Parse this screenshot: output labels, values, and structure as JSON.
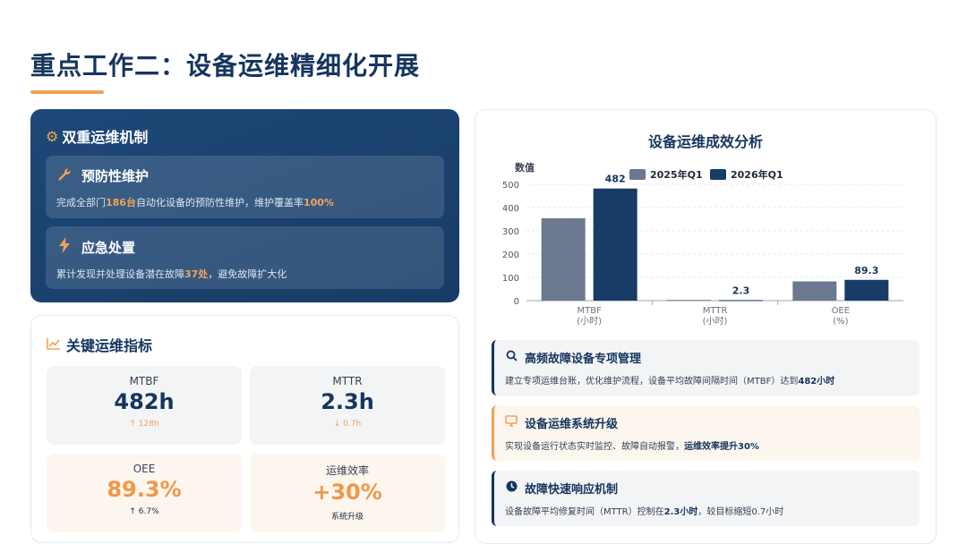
{
  "header": {
    "title": "重点工作二：设备运维精细化开展"
  },
  "mechanism": {
    "title": "双重运维机制",
    "title_icon": "gear-icon",
    "items": [
      {
        "icon": "wrench-icon",
        "title": "预防性维护",
        "desc_prefix": "完成全部门",
        "desc_highlight1": "186台",
        "desc_mid": "自动化设备的预防性维护，维护覆盖率",
        "desc_highlight2": "100%"
      },
      {
        "icon": "lightning-icon",
        "title": "应急处置",
        "desc_prefix": "累计发现并处理设备潜在故障",
        "desc_highlight1": "37处",
        "desc_suffix": "，避免故障扩大化"
      }
    ]
  },
  "metrics": {
    "title": "关键运维指标",
    "title_icon": "trend-chart-icon",
    "items": [
      {
        "label": "MTBF",
        "value": "482h",
        "sub": "↑ 128h"
      },
      {
        "label": "MTTR",
        "value": "2.3h",
        "sub": "↓ 0.7h"
      },
      {
        "label": "OEE",
        "value": "89.3%",
        "sub": "↑ 6.7%"
      },
      {
        "label": "运维效率",
        "value": "+30%",
        "sub": "系统升级"
      }
    ]
  },
  "analysis": {
    "title": "设备运维成效分析",
    "points": [
      {
        "icon": "search-icon",
        "title": "高频故障设备专项管理",
        "desc": "建立专项运维台账，优化维护流程，设备平均故障间隔时间（MTBF）达到",
        "desc_highlight": "482小时"
      },
      {
        "icon": "monitor-icon",
        "title": "设备运维系统升级",
        "desc": "实现设备运行状态实时监控、故障自动报警，",
        "desc_highlight": "运维效率提升30%"
      },
      {
        "icon": "clock-icon",
        "title": "故障快速响应机制",
        "desc_prefix": "设备故障平均修复时间（MTTR）控制在",
        "desc_highlight": "2.3小时",
        "desc_suffix": "，较目标缩短0.7小时"
      }
    ]
  },
  "colors": {
    "navy": "#15355e",
    "accent_orange": "#f1a155",
    "series_2025": "#6b7890",
    "series_2026": "#173c66"
  },
  "chart_data": {
    "type": "bar",
    "ylabel": "数值",
    "ylim": [
      0,
      500
    ],
    "yticks": [
      0,
      100,
      200,
      300,
      400,
      500
    ],
    "grid": true,
    "legend_position": "top",
    "categories": [
      {
        "name": "MTBF",
        "unit": "(小时)"
      },
      {
        "name": "MTTR",
        "unit": "(小时)"
      },
      {
        "name": "OEE",
        "unit": "(%)"
      }
    ],
    "series": [
      {
        "name": "2025年Q1",
        "values": [
          354,
          3,
          82.6
        ]
      },
      {
        "name": "2026年Q1",
        "values": [
          482,
          2.3,
          89.3
        ]
      }
    ],
    "data_labels": [
      "482",
      "2.3",
      "89.3"
    ]
  }
}
